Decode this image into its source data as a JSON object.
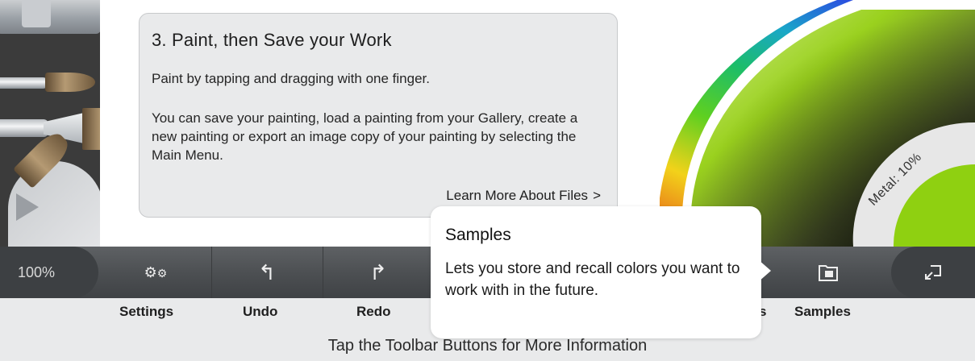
{
  "info_card": {
    "title": "3. Paint, then Save your Work",
    "paragraph1": "Paint by tapping and dragging with one finger.",
    "paragraph2": "You can save your painting, load a painting from your Gallery, create a new painting or export an image copy of your painting by selecting the Main Menu.",
    "learn_more_label": "Learn More About Files",
    "learn_more_chevron": ">"
  },
  "color_picker": {
    "metal_label": "Metal: 10%",
    "current_color": "#8fd011"
  },
  "toolbar": {
    "zoom_label": "100%",
    "buttons": [
      {
        "label": "Settings",
        "icon": "gears-icon"
      },
      {
        "label": "Undo",
        "icon": "undo-arrow-icon"
      },
      {
        "label": "Redo",
        "icon": "redo-arrow-icon"
      },
      {
        "label": "s",
        "icon": "hidden"
      },
      {
        "label": "Samples",
        "icon": "samples-folder-icon"
      }
    ],
    "export_icon": "export-icon"
  },
  "hint": "Tap the Toolbar Buttons for More Information",
  "popover": {
    "title": "Samples",
    "body": "Lets you store and recall colors you want to work with in the future."
  }
}
